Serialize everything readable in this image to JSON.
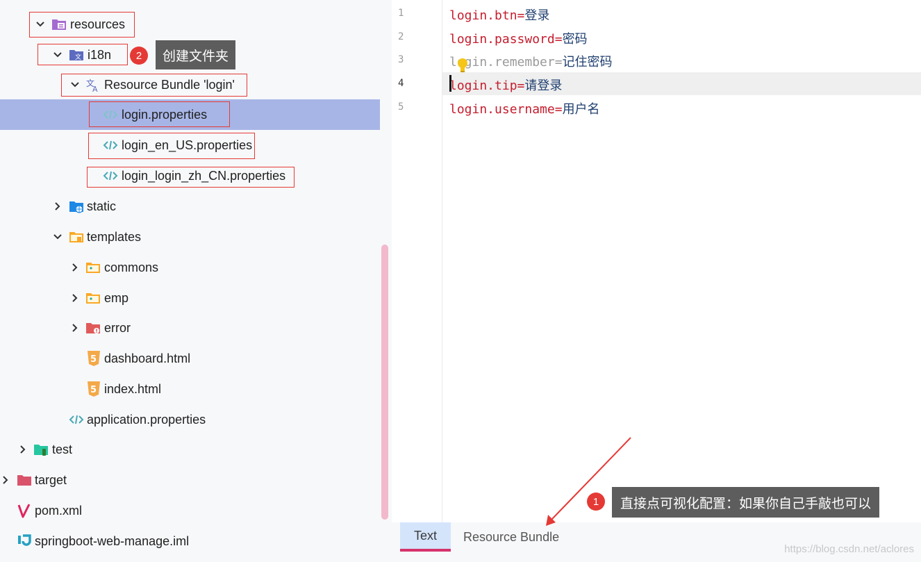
{
  "tree": {
    "items": [
      {
        "label": "resources",
        "icon": "resources-folder-icon",
        "expanded": true
      },
      {
        "label": "i18n",
        "icon": "i18n-folder-icon",
        "expanded": true
      },
      {
        "label": "Resource Bundle 'login'",
        "icon": "resource-bundle-icon",
        "expanded": true
      },
      {
        "label": "login.properties",
        "icon": "properties-file-icon",
        "selected": true
      },
      {
        "label": "login_en_US.properties",
        "icon": "properties-file-icon"
      },
      {
        "label": "login_login_zh_CN.properties",
        "icon": "properties-file-icon"
      },
      {
        "label": "static",
        "icon": "web-folder-icon",
        "expanded": false
      },
      {
        "label": "templates",
        "icon": "templates-folder-icon",
        "expanded": true
      },
      {
        "label": "commons",
        "icon": "folder-icon",
        "expanded": false
      },
      {
        "label": "emp",
        "icon": "folder-icon",
        "expanded": false
      },
      {
        "label": "error",
        "icon": "error-folder-icon",
        "expanded": false
      },
      {
        "label": "dashboard.html",
        "icon": "html5-icon"
      },
      {
        "label": "index.html",
        "icon": "html5-icon"
      },
      {
        "label": "application.properties",
        "icon": "properties-file-icon"
      },
      {
        "label": "test",
        "icon": "test-folder-icon",
        "expanded": false
      },
      {
        "label": "target",
        "icon": "target-folder-icon",
        "expanded": false
      },
      {
        "label": "pom.xml",
        "icon": "maven-icon"
      },
      {
        "label": "springboot-web-manage.iml",
        "icon": "iml-icon"
      }
    ]
  },
  "editor": {
    "lines": [
      {
        "number": "1",
        "key": "login.btn=",
        "value": "登录"
      },
      {
        "number": "2",
        "key": "login.password=",
        "value": "密码"
      },
      {
        "number": "3",
        "key": "login.remember=",
        "value": "记住密码"
      },
      {
        "number": "4",
        "key": "login.tip=",
        "value": "请登录",
        "current": true
      },
      {
        "number": "5",
        "key": "login.username=",
        "value": "用户名"
      }
    ]
  },
  "tabs": [
    {
      "label": "Text",
      "active": true
    },
    {
      "label": "Resource Bundle",
      "active": false
    }
  ],
  "annotations": {
    "badge1": "1",
    "callout1": "直接点可视化配置：如果你自己手敲也可以",
    "badge2": "2",
    "callout2": "创建文件夹"
  },
  "watermark": "https://blog.csdn.net/aclores",
  "colors": {
    "selection": "#a7b5e6",
    "key": "#c51d2d",
    "value": "#1f3f6f",
    "annotation_red": "#e53935",
    "active_tab": "#d4e4fb",
    "tab_underline": "#d6336c"
  }
}
